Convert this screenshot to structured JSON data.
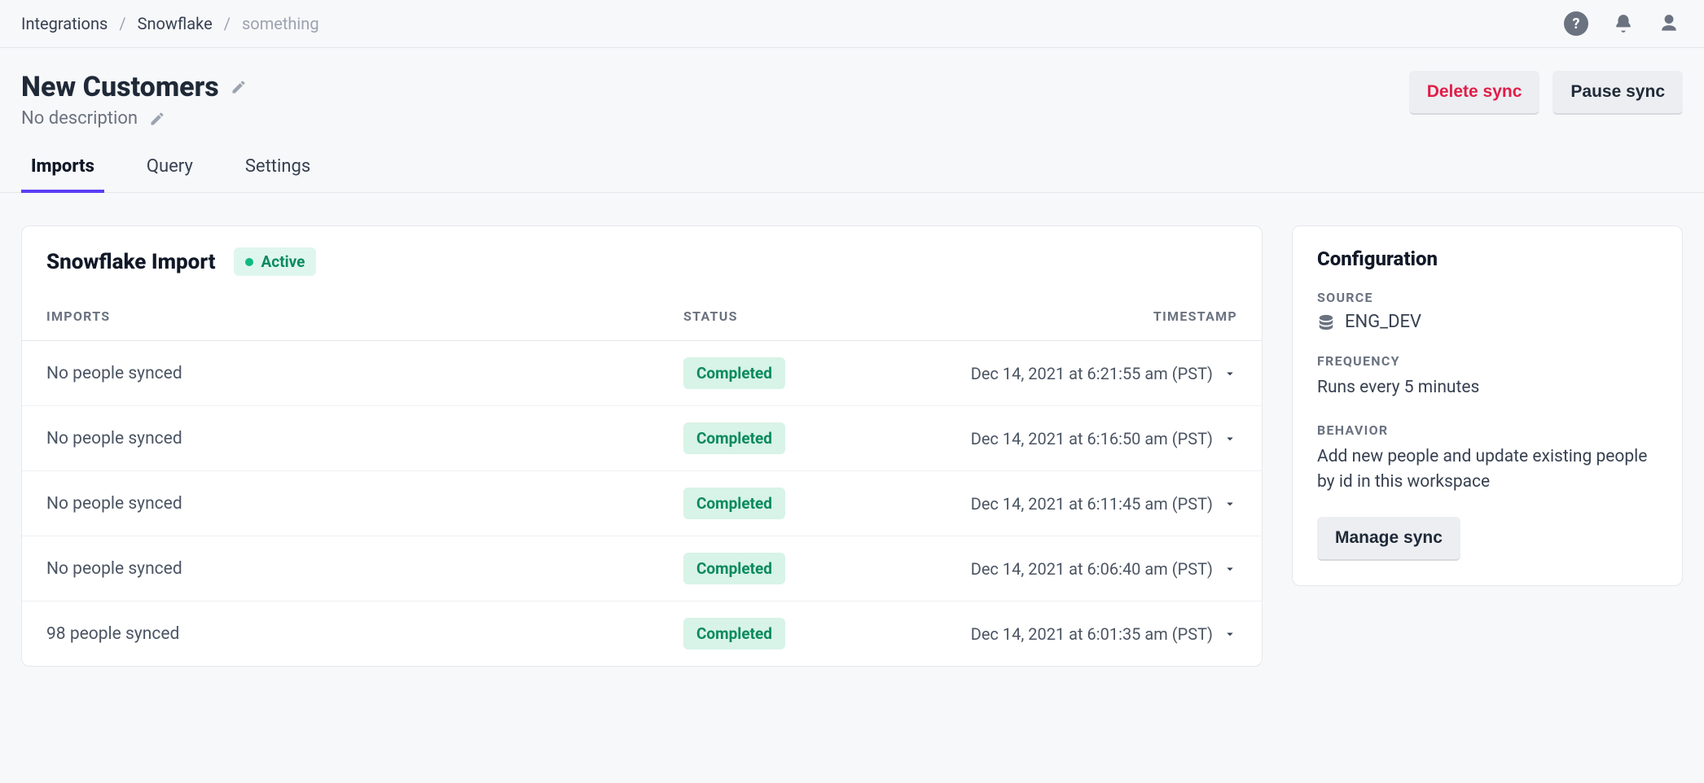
{
  "breadcrumbs": {
    "items": [
      {
        "label": "Integrations"
      },
      {
        "label": "Snowflake"
      },
      {
        "label": "something"
      }
    ]
  },
  "header": {
    "title": "New Customers",
    "description": "No description",
    "delete_label": "Delete sync",
    "pause_label": "Pause sync"
  },
  "tabs": [
    {
      "label": "Imports",
      "active": true
    },
    {
      "label": "Query",
      "active": false
    },
    {
      "label": "Settings",
      "active": false
    }
  ],
  "panel": {
    "title": "Snowflake Import",
    "status_badge": "Active",
    "columns": {
      "imports": "IMPORTS",
      "status": "STATUS",
      "timestamp": "TIMESTAMP"
    },
    "rows": [
      {
        "imports": "No people synced",
        "status": "Completed",
        "timestamp": "Dec 14, 2021 at 6:21:55 am (PST)"
      },
      {
        "imports": "No people synced",
        "status": "Completed",
        "timestamp": "Dec 14, 2021 at 6:16:50 am (PST)"
      },
      {
        "imports": "No people synced",
        "status": "Completed",
        "timestamp": "Dec 14, 2021 at 6:11:45 am (PST)"
      },
      {
        "imports": "No people synced",
        "status": "Completed",
        "timestamp": "Dec 14, 2021 at 6:06:40 am (PST)"
      },
      {
        "imports": "98 people synced",
        "status": "Completed",
        "timestamp": "Dec 14, 2021 at 6:01:35 am (PST)"
      }
    ]
  },
  "config": {
    "title": "Configuration",
    "source_label": "SOURCE",
    "source_value": "ENG_DEV",
    "frequency_label": "FREQUENCY",
    "frequency_value": "Runs every 5 minutes",
    "behavior_label": "BEHAVIOR",
    "behavior_value": "Add new people and update existing people by id in this workspace",
    "manage_label": "Manage sync"
  }
}
